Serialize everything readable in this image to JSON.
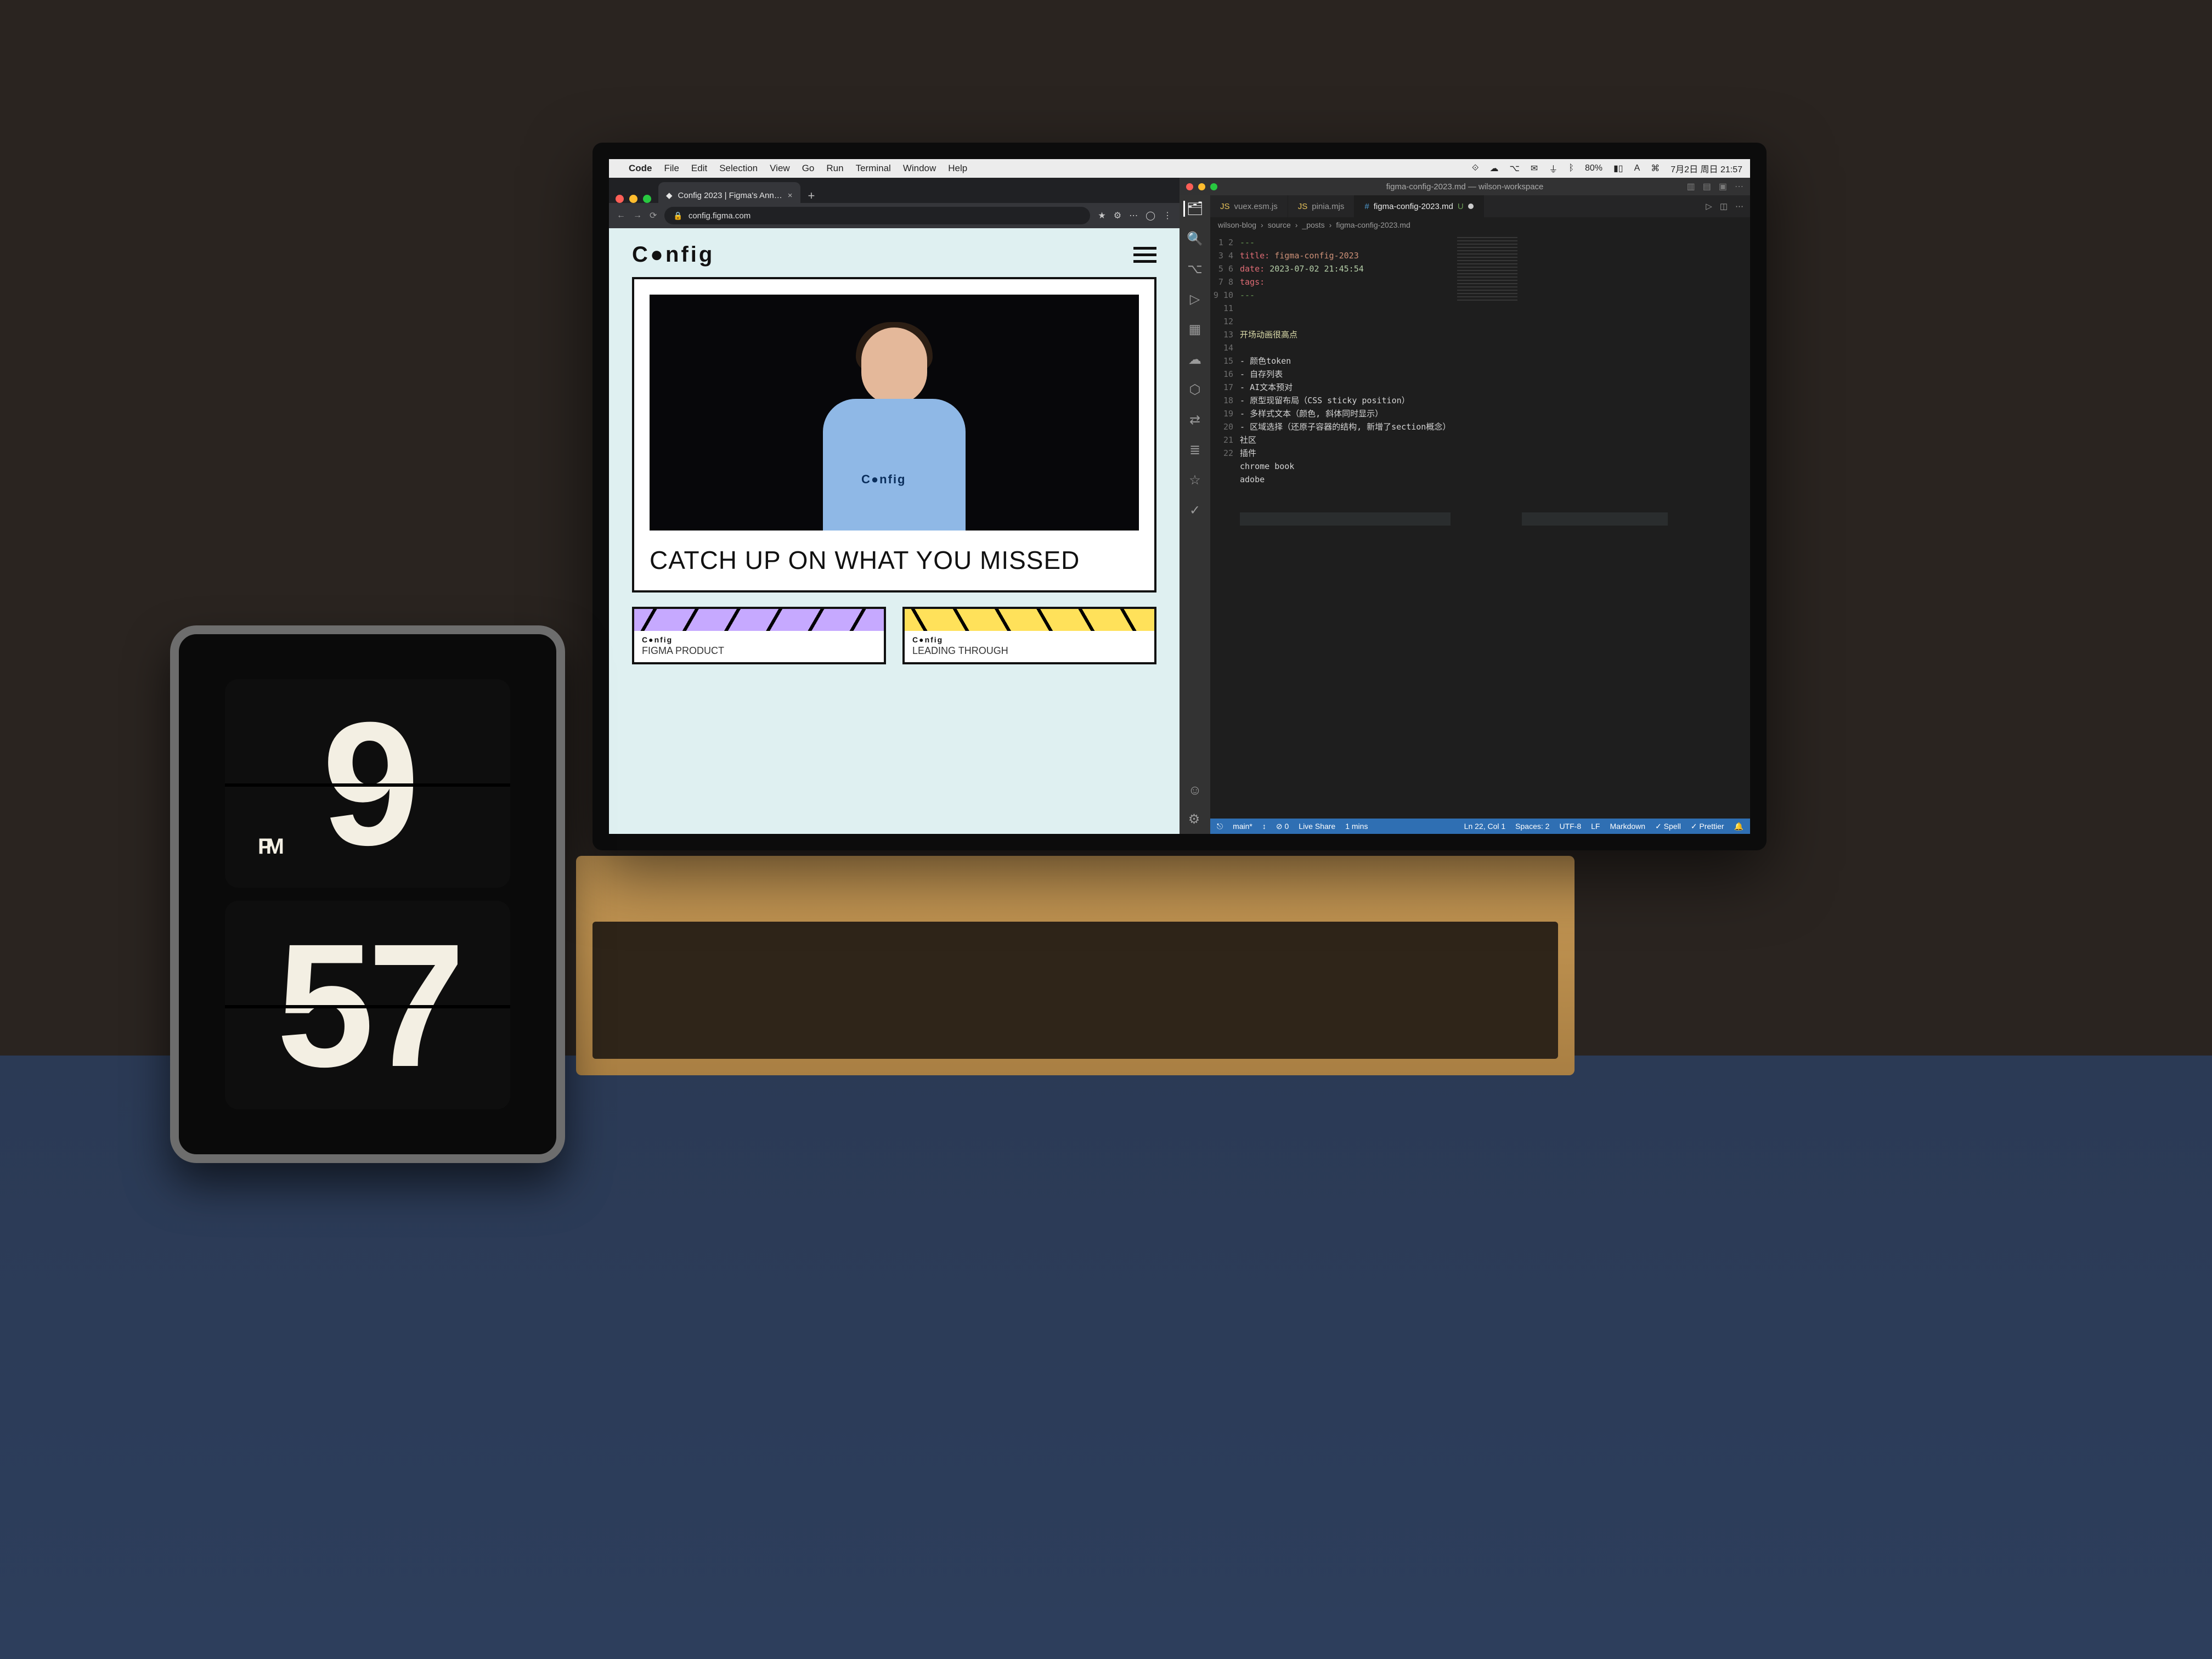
{
  "menubar": {
    "apple": "",
    "app": "Code",
    "items": [
      "File",
      "Edit",
      "Selection",
      "View",
      "Go",
      "Run",
      "Terminal",
      "Window",
      "Help"
    ],
    "right": {
      "battery": "80%",
      "date": "7月2日 周日 21:57"
    }
  },
  "chrome": {
    "tab_title": "Config 2023 | Figma's Ann…",
    "url": "config.figma.com",
    "page": {
      "brand": "C●nfig",
      "hero_shirt": "C●nfig",
      "hero_title": "CATCH UP ON WHAT YOU MISSED",
      "tracks": [
        {
          "tag": "C●nfig",
          "title": "FIGMA PRODUCT"
        },
        {
          "tag": "C●nfig",
          "title": "LEADING THROUGH"
        }
      ]
    }
  },
  "vscode": {
    "title": "figma-config-2023.md — wilson-workspace",
    "tabs": [
      {
        "label": "vuex.esm.js",
        "modified": false
      },
      {
        "label": "pinia.mjs",
        "modified": false
      },
      {
        "label": "figma-config-2023.md",
        "modified": true,
        "suffix": "U"
      }
    ],
    "breadcrumbs": [
      "wilson-blog",
      "source",
      "_posts",
      "figma-config-2023.md"
    ],
    "code_lines": [
      "---",
      "title: figma-config-2023",
      "date: 2023-07-02 21:45:54",
      "tags:",
      "---",
      "",
      "",
      "开场动画很高点",
      "",
      "- 颜色token",
      "- 自存列表",
      "- AI文本预对",
      "- 原型现留布局（CSS sticky position）",
      "- 多样式文本（颜色, 斜体同时显示）",
      "- 区域选择（还原子容器的结构, 新增了section概念）",
      "社区",
      "插件",
      "chrome book",
      "adobe",
      "",
      "",
      ""
    ],
    "status": {
      "branch": "main*",
      "sync": "↕",
      "errors": "⊘ 0",
      "live_share": "Live Share",
      "port": "1 mins",
      "cursor": "Ln 22, Col 1",
      "spaces": "Spaces: 2",
      "encoding": "UTF-8",
      "eol": "LF",
      "lang": "Markdown",
      "spell": "✓ Spell",
      "prettier": "✓ Prettier",
      "bell": "🔔"
    }
  },
  "ipad": {
    "ampm": "PM",
    "hour": "9",
    "minute": "57"
  }
}
